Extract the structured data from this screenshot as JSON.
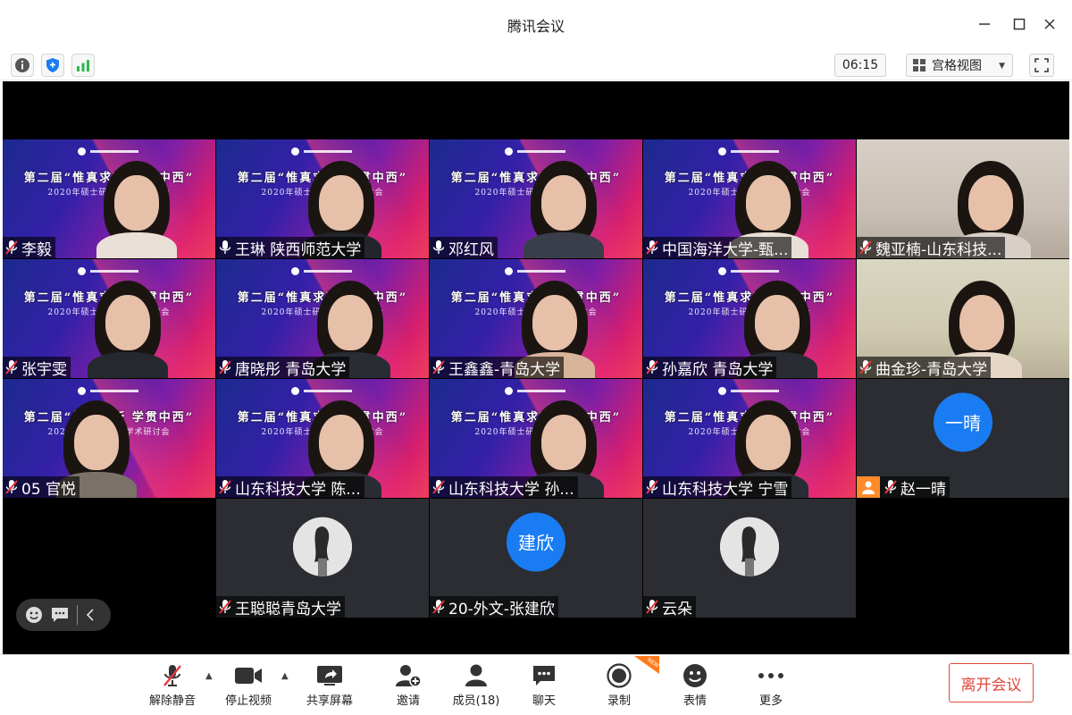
{
  "window": {
    "title": "腾讯会议"
  },
  "infobar": {
    "timer": "06:15",
    "view_mode": "宫格视图"
  },
  "participants": [
    {
      "name": "李毅",
      "muted": true
    },
    {
      "name": "王琳  陕西师范大学",
      "muted": false
    },
    {
      "name": "邓红风",
      "muted": false
    },
    {
      "name": "中国海洋大学-甄...",
      "muted": true
    },
    {
      "name": "魏亚楠-山东科技...",
      "muted": true
    },
    {
      "name": "张宇雯",
      "muted": true
    },
    {
      "name": "唐晓彤 青岛大学",
      "muted": true
    },
    {
      "name": "王鑫鑫-青岛大学",
      "muted": true
    },
    {
      "name": "孙嘉欣 青岛大学",
      "muted": true
    },
    {
      "name": "曲金珍-青岛大学",
      "muted": true
    },
    {
      "name": "05 官悦",
      "muted": true
    },
    {
      "name": "山东科技大学 陈...",
      "muted": true
    },
    {
      "name": "山东科技大学 孙...",
      "muted": true
    },
    {
      "name": "山东科技大学   宁雪",
      "muted": true
    },
    {
      "name": "赵一晴",
      "muted": true,
      "avatar_text": "一晴",
      "host_icon": true
    },
    {
      "name": "王聪聪青岛大学",
      "muted": true
    },
    {
      "name": "20-外文-张建欣",
      "muted": true,
      "avatar_text": "建欣"
    },
    {
      "name": "云朵",
      "muted": true
    }
  ],
  "banner": {
    "line1": "第二届“惟真求新  学贯中西”",
    "line2": "2020年硕士研究生学术研讨会"
  },
  "toolbar": {
    "unmute": "解除静音",
    "stop_video": "停止视频",
    "share_screen": "共享屏幕",
    "invite": "邀请",
    "members": "成员(18)",
    "chat": "聊天",
    "record": "录制",
    "reactions": "表情",
    "more": "更多",
    "new_badge": "NEW",
    "leave": "离开会议"
  },
  "colors": {
    "accent_blue": "#1a7cf2",
    "leave_red": "#e0463a",
    "host_orange": "#ff8a2a",
    "mute_red": "#e8383d"
  }
}
